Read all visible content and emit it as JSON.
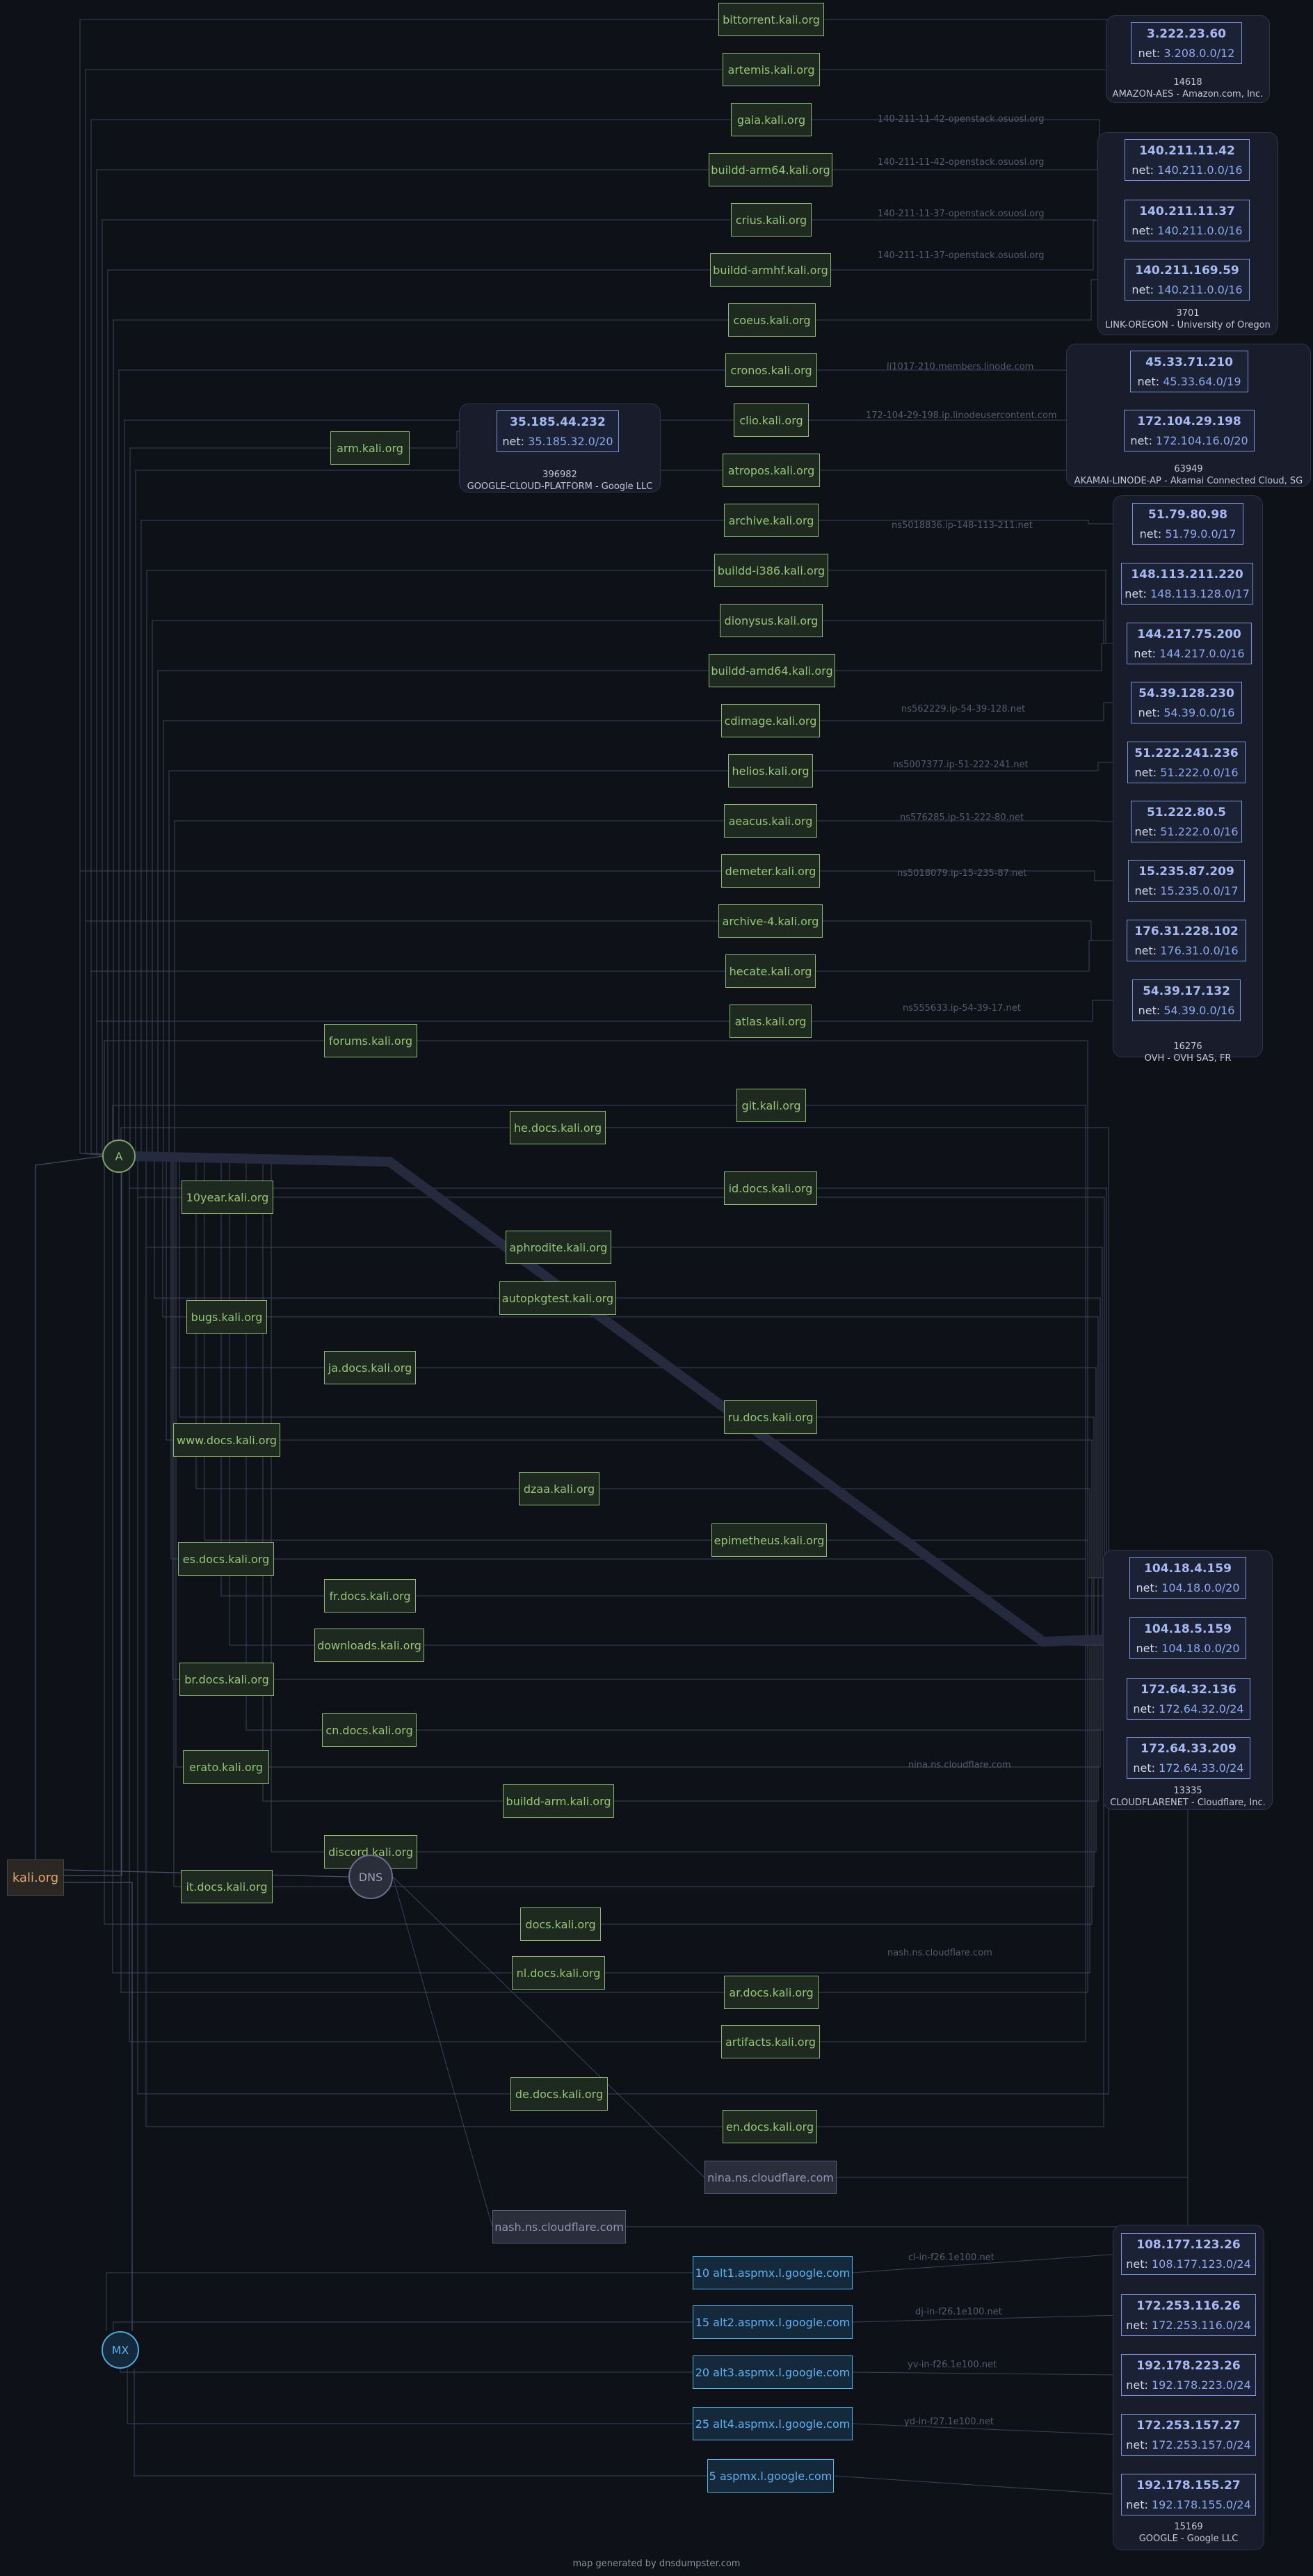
{
  "root": "kali.org",
  "hubs": {
    "a": "A",
    "dns": "DNS",
    "mx": "MX"
  },
  "subdomains": [
    {
      "n": "bittorrent.kali.org",
      "ip": "3.222.23.60"
    },
    {
      "n": "artemis.kali.org",
      "ip": "3.222.23.60"
    },
    {
      "n": "gaia.kali.org",
      "ip": "140.211.11.42"
    },
    {
      "n": "buildd-arm64.kali.org",
      "ip": "140.211.11.42"
    },
    {
      "n": "crius.kali.org",
      "ip": "140.211.11.37"
    },
    {
      "n": "buildd-armhf.kali.org",
      "ip": "140.211.11.37"
    },
    {
      "n": "coeus.kali.org",
      "ip": "140.211.169.59"
    },
    {
      "n": "cronos.kali.org",
      "ip": "45.33.71.210"
    },
    {
      "n": "clio.kali.org",
      "ip": "172.104.29.198"
    },
    {
      "n": "arm.kali.org",
      "ip": "35.185.44.232"
    },
    {
      "n": "atropos.kali.org",
      "ip": "45.33.71.210"
    },
    {
      "n": "archive.kali.org",
      "ip": "51.79.80.98"
    },
    {
      "n": "buildd-i386.kali.org",
      "ip": "144.217.75.200"
    },
    {
      "n": "dionysus.kali.org",
      "ip": "144.217.75.200"
    },
    {
      "n": "buildd-amd64.kali.org",
      "ip": "144.217.75.200"
    },
    {
      "n": "cdimage.kali.org",
      "ip": "54.39.128.230"
    },
    {
      "n": "helios.kali.org",
      "ip": "51.222.241.236"
    },
    {
      "n": "aeacus.kali.org",
      "ip": "51.222.80.5"
    },
    {
      "n": "demeter.kali.org",
      "ip": "15.235.87.209"
    },
    {
      "n": "archive-4.kali.org",
      "ip": "176.31.228.102"
    },
    {
      "n": "hecate.kali.org",
      "ip": "176.31.228.102"
    },
    {
      "n": "atlas.kali.org",
      "ip": "54.39.17.132"
    },
    {
      "n": "forums.kali.org",
      "ip": "104.18.5.159"
    },
    {
      "n": "git.kali.org",
      "ip": "104.18.5.159"
    },
    {
      "n": "he.docs.kali.org",
      "ip": "104.18.5.159"
    },
    {
      "n": "id.docs.kali.org",
      "ip": "104.18.5.159"
    },
    {
      "n": "10year.kali.org",
      "ip": "104.18.4.159"
    },
    {
      "n": "aphrodite.kali.org",
      "ip": "104.18.5.159"
    },
    {
      "n": "autopkgtest.kali.org",
      "ip": "104.18.4.159"
    },
    {
      "n": "bugs.kali.org",
      "ip": "104.18.5.159"
    },
    {
      "n": "ja.docs.kali.org",
      "ip": "104.18.4.159"
    },
    {
      "n": "ru.docs.kali.org",
      "ip": "104.18.5.159"
    },
    {
      "n": "www.docs.kali.org",
      "ip": "104.18.5.159"
    },
    {
      "n": "dzaa.kali.org",
      "ip": "104.18.4.159"
    },
    {
      "n": "epimetheus.kali.org",
      "ip": "104.18.4.159"
    },
    {
      "n": "es.docs.kali.org",
      "ip": "104.18.5.159"
    },
    {
      "n": "fr.docs.kali.org",
      "ip": "104.18.5.159"
    },
    {
      "n": "downloads.kali.org",
      "ip": "104.18.5.159"
    },
    {
      "n": "br.docs.kali.org",
      "ip": "104.18.5.159"
    },
    {
      "n": "cn.docs.kali.org",
      "ip": "104.18.5.159"
    },
    {
      "n": "erato.kali.org",
      "ip": "104.18.5.159"
    },
    {
      "n": "buildd-arm.kali.org",
      "ip": "104.18.5.159"
    },
    {
      "n": "discord.kali.org",
      "ip": "104.18.5.159"
    },
    {
      "n": "it.docs.kali.org",
      "ip": "104.18.5.159"
    },
    {
      "n": "docs.kali.org",
      "ip": "104.18.5.159"
    },
    {
      "n": "nl.docs.kali.org",
      "ip": "104.18.5.159"
    },
    {
      "n": "ar.docs.kali.org",
      "ip": "104.18.5.159"
    },
    {
      "n": "artifacts.kali.org",
      "ip": "104.18.5.159"
    },
    {
      "n": "de.docs.kali.org",
      "ip": "104.18.5.159"
    },
    {
      "n": "en.docs.kali.org",
      "ip": "172.64.32.136"
    }
  ],
  "nameservers": [
    {
      "n": "nina.ns.cloudflare.com",
      "ip": "172.64.33.209"
    },
    {
      "n": "nash.ns.cloudflare.com",
      "ip": "172.64.32.136"
    }
  ],
  "mx": [
    {
      "n": "10 alt1.aspmx.l.google.com",
      "ip": "108.177.123.26"
    },
    {
      "n": "15 alt2.aspmx.l.google.com",
      "ip": "172.253.116.26"
    },
    {
      "n": "20 alt3.aspmx.l.google.com",
      "ip": "192.178.223.26"
    },
    {
      "n": "25 alt4.aspmx.l.google.com",
      "ip": "172.253.157.27"
    },
    {
      "n": "5 aspmx.l.google.com",
      "ip": "192.178.155.27"
    }
  ],
  "net_prefix": "net: ",
  "ips": [
    {
      "ip": "3.222.23.60",
      "net": "3.208.0.0/12"
    },
    {
      "ip": "140.211.11.42",
      "net": "140.211.0.0/16"
    },
    {
      "ip": "140.211.11.37",
      "net": "140.211.0.0/16"
    },
    {
      "ip": "140.211.169.59",
      "net": "140.211.0.0/16"
    },
    {
      "ip": "45.33.71.210",
      "net": "45.33.64.0/19"
    },
    {
      "ip": "172.104.29.198",
      "net": "172.104.16.0/20"
    },
    {
      "ip": "35.185.44.232",
      "net": "35.185.32.0/20"
    },
    {
      "ip": "51.79.80.98",
      "net": "51.79.0.0/17"
    },
    {
      "ip": "148.113.211.220",
      "net": "148.113.128.0/17"
    },
    {
      "ip": "144.217.75.200",
      "net": "144.217.0.0/16"
    },
    {
      "ip": "54.39.128.230",
      "net": "54.39.0.0/16"
    },
    {
      "ip": "51.222.241.236",
      "net": "51.222.0.0/16"
    },
    {
      "ip": "51.222.80.5",
      "net": "51.222.0.0/16"
    },
    {
      "ip": "15.235.87.209",
      "net": "15.235.0.0/17"
    },
    {
      "ip": "176.31.228.102",
      "net": "176.31.0.0/16"
    },
    {
      "ip": "54.39.17.132",
      "net": "54.39.0.0/16"
    },
    {
      "ip": "104.18.4.159",
      "net": "104.18.0.0/20"
    },
    {
      "ip": "104.18.5.159",
      "net": "104.18.0.0/20"
    },
    {
      "ip": "172.64.32.136",
      "net": "172.64.32.0/24"
    },
    {
      "ip": "172.64.33.209",
      "net": "172.64.33.0/24"
    },
    {
      "ip": "108.177.123.26",
      "net": "108.177.123.0/24"
    },
    {
      "ip": "172.253.116.26",
      "net": "172.253.116.0/24"
    },
    {
      "ip": "192.178.223.26",
      "net": "192.178.223.0/24"
    },
    {
      "ip": "172.253.157.27",
      "net": "172.253.157.0/24"
    },
    {
      "ip": "192.178.155.27",
      "net": "192.178.155.0/24"
    }
  ],
  "groups": [
    {
      "asn": "14618",
      "name": "AMAZON-AES - Amazon.com, Inc."
    },
    {
      "asn": "3701",
      "name": "LINK-OREGON - University of Oregon"
    },
    {
      "asn": "396982",
      "name": "GOOGLE-CLOUD-PLATFORM - Google LLC"
    },
    {
      "asn": "63949",
      "name": "AKAMAI-LINODE-AP - Akamai Connected Cloud, SG"
    },
    {
      "asn": "16276",
      "name": "OVH - OVH SAS, FR"
    },
    {
      "asn": "13335",
      "name": "CLOUDFLARENET - Cloudflare, Inc."
    },
    {
      "asn": "15169",
      "name": "GOOGLE - Google LLC"
    }
  ],
  "rdns": [
    "140-211-11-42-openstack.osuosl.org",
    "140-211-11-42-openstack.osuosl.org",
    "140-211-11-37-openstack.osuosl.org",
    "140-211-11-37-openstack.osuosl.org",
    "li1017-210.members.linode.com",
    "172-104-29-198.ip.linodeusercontent.com",
    "ns5018836.ip-148-113-211.net",
    "ns562229.ip-54-39-128.net",
    "ns5007377.ip-51-222-241.net",
    "ns576285.ip-51-222-80.net",
    "ns5018079.ip-15-235-87.net",
    "ns555633.ip-54-39-17.net",
    "nina.ns.cloudflare.com",
    "nash.ns.cloudflare.com",
    "cl-in-f26.1e100.net",
    "dj-in-f26.1e100.net",
    "yv-in-f26.1e100.net",
    "yd-in-f27.1e100.net"
  ],
  "footer": "map generated by dnsdumpster.com"
}
